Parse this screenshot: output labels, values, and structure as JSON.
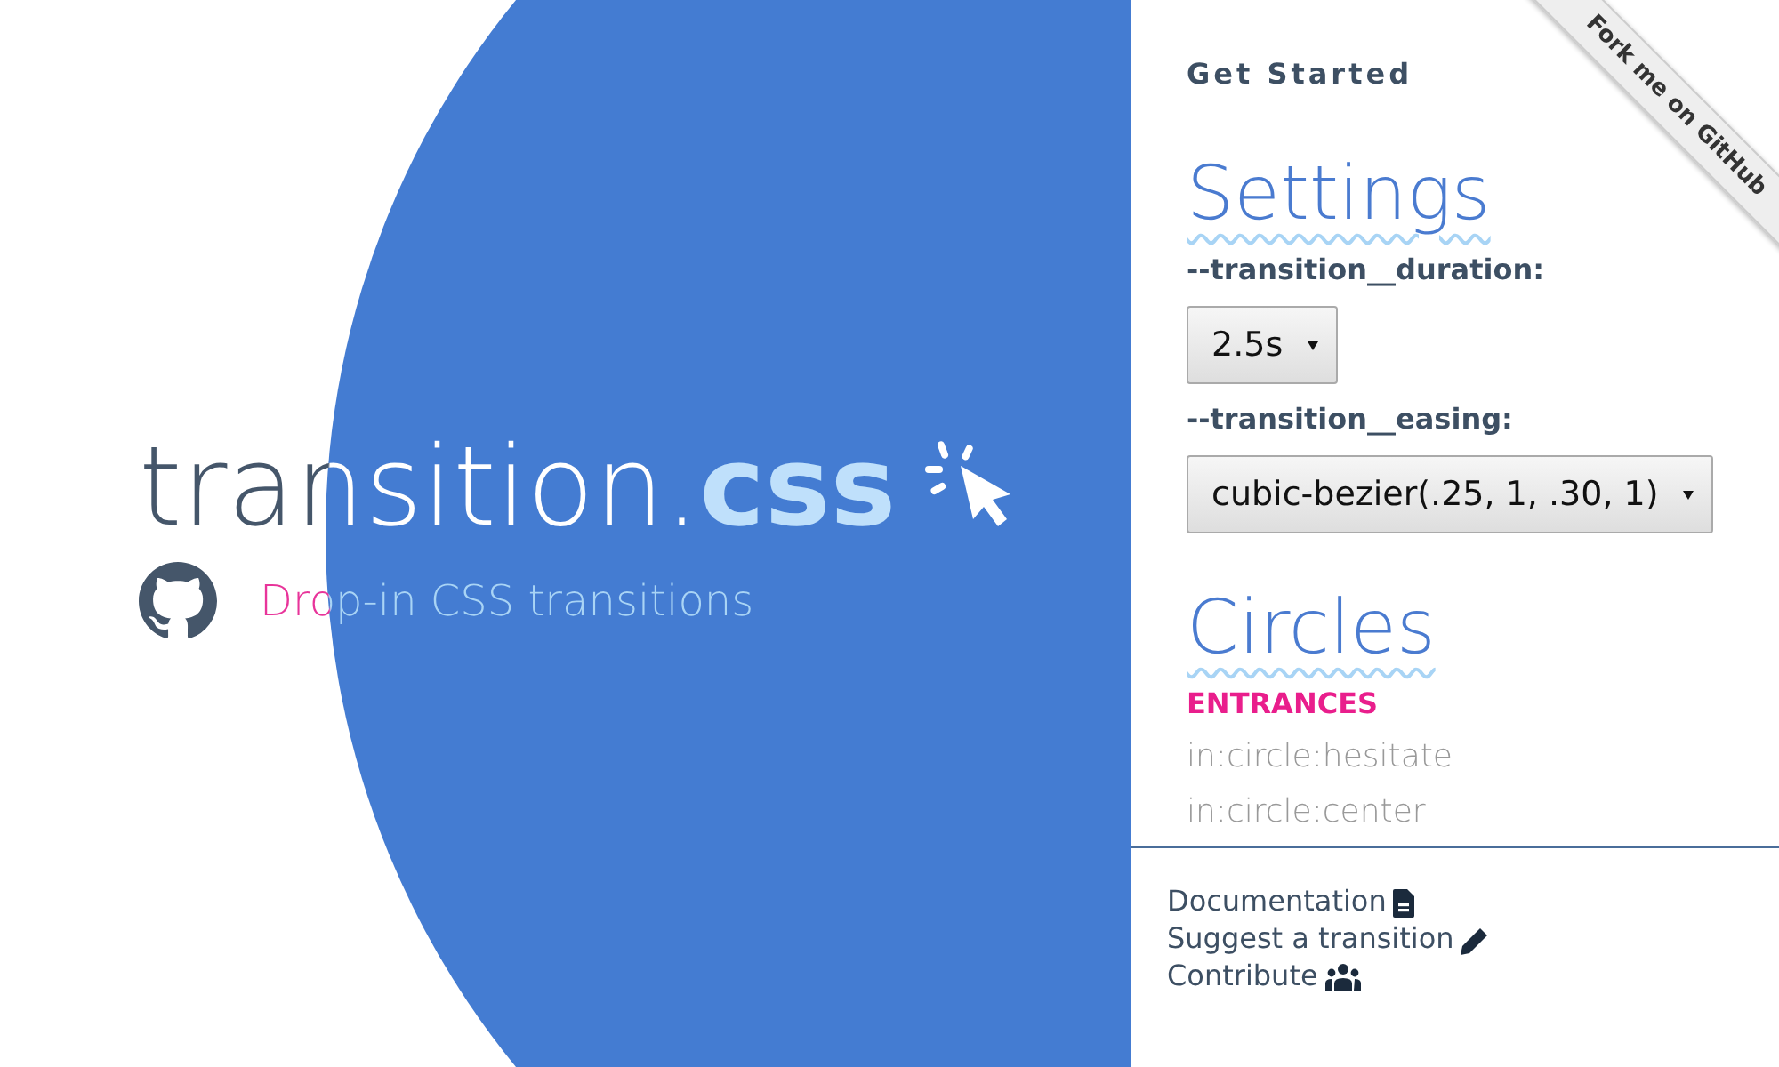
{
  "hero": {
    "title": "transition.",
    "title_accent": "css",
    "tagline": "Drop-in CSS transitions"
  },
  "sidebar": {
    "get_started": "Get Started",
    "settings": {
      "heading": "Settings",
      "fields": [
        {
          "label": "--transition__duration:",
          "value": "2.5s"
        },
        {
          "label": "--transition__easing:",
          "value": "cubic-bezier(.25, 1, .30, 1)"
        }
      ]
    },
    "circles": {
      "heading": "Circles",
      "group": "ENTRANCES",
      "items": [
        "in:circle:hesitate",
        "in:circle:center"
      ]
    },
    "footer_links": [
      {
        "label": "Documentation",
        "kind": "document"
      },
      {
        "label": "Suggest a transition",
        "kind": "pencil"
      },
      {
        "label": "Contribute",
        "kind": "people"
      }
    ]
  },
  "ribbon": "Fork me on GitHub"
}
